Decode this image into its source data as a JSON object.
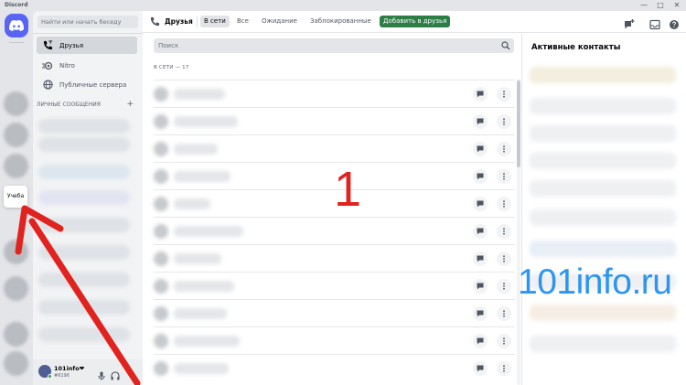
{
  "window": {
    "title": "Discord",
    "controls": [
      "—",
      "□",
      "✕"
    ]
  },
  "server_rail": {
    "tooltip": "Учеба"
  },
  "sidebar": {
    "search_placeholder": "Найти или начать беседу",
    "items": [
      {
        "label": "Друзья",
        "icon": "friends-icon"
      },
      {
        "label": "Nitro",
        "icon": "nitro-icon"
      },
      {
        "label": "Публичные сервера",
        "icon": "globe-icon"
      }
    ],
    "dm_header": "ЛИЧНЫЕ СООБЩЕНИЯ",
    "dm_add": "+"
  },
  "user_panel": {
    "name": "101info❤",
    "tag": "#6196"
  },
  "topbar": {
    "title": "Друзья",
    "tabs": [
      "В сети",
      "Все",
      "Ожидание",
      "Заблокированные"
    ],
    "add_friend": "Добавить в друзья"
  },
  "main": {
    "search_placeholder": "Поиск",
    "online_count": "В СЕТИ — 17"
  },
  "active_contacts": {
    "title": "Активные контакты"
  },
  "overlays": {
    "number": "1",
    "watermark": "101info.ru"
  },
  "colors": {
    "brand": "#5865f2",
    "add_button": "#2d7d46",
    "arrow": "#e0231f",
    "watermark": "#2b95f0",
    "online": "#3ba55c"
  }
}
